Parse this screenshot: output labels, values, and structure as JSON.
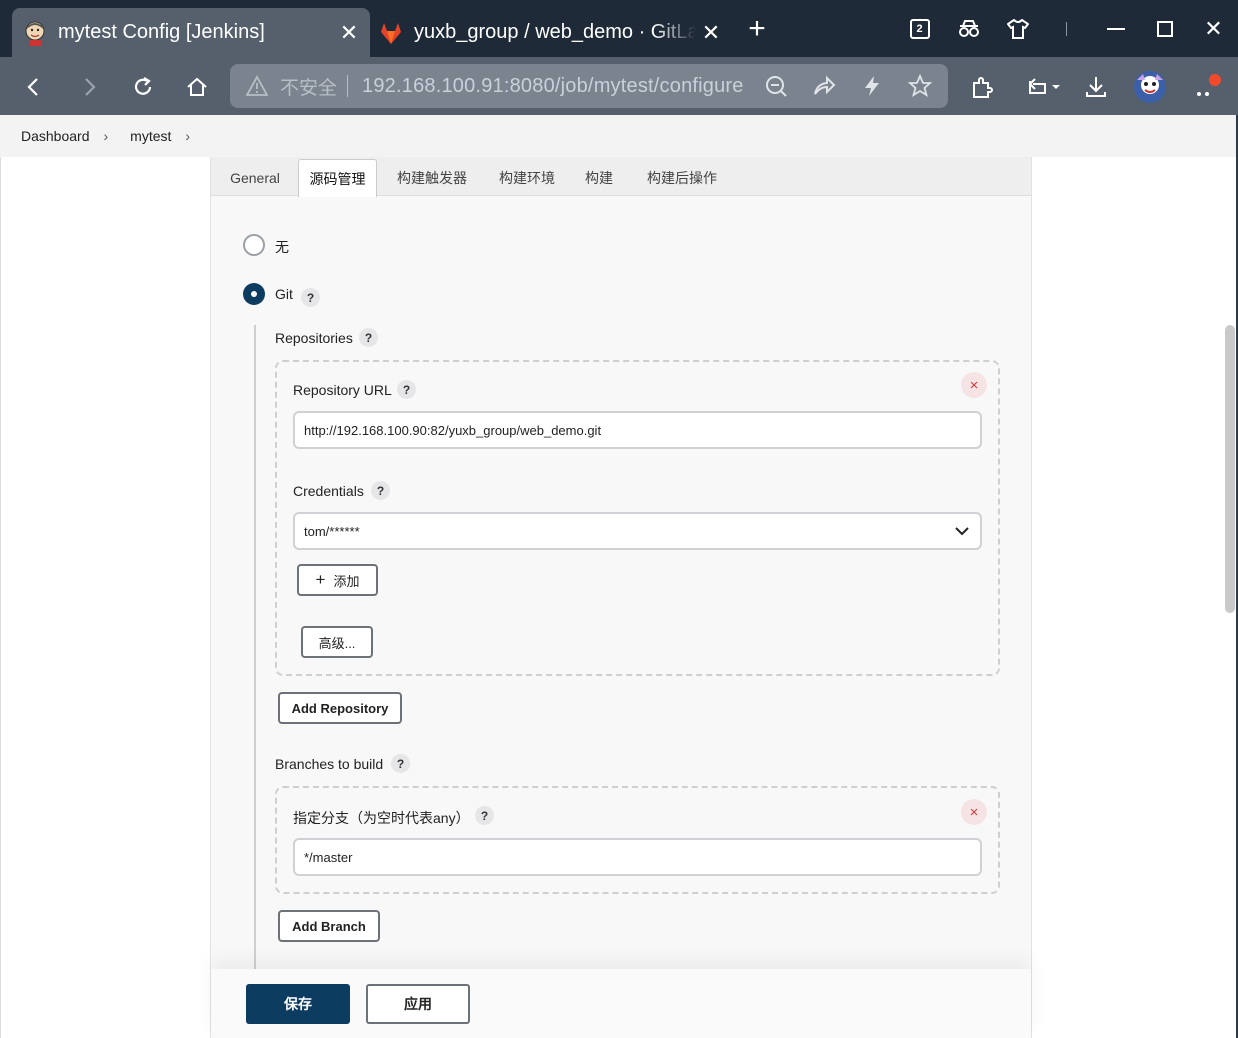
{
  "browser": {
    "tabs": [
      {
        "title": "mytest Config [Jenkins]",
        "active": true,
        "icon": "jenkins-icon"
      },
      {
        "title": "yuxb_group / web_demo · GitLab",
        "active": false,
        "icon": "gitlab-icon"
      }
    ],
    "tab_count": "2",
    "address": {
      "security_label": "不安全",
      "url": "192.168.100.91:8080/job/mytest/configure"
    }
  },
  "breadcrumb": [
    "Dashboard",
    "mytest"
  ],
  "config_tabs": [
    "General",
    "源码管理",
    "构建触发器",
    "构建环境",
    "构建",
    "构建后操作"
  ],
  "selected_tab": "源码管理",
  "scm": {
    "option_none": "无",
    "option_git": "Git",
    "selected": "Git",
    "repositories_label": "Repositories",
    "repository_url_label": "Repository URL",
    "repository_url_value": "http://192.168.100.90:82/yuxb_group/web_demo.git",
    "credentials_label": "Credentials",
    "credentials_value": "tom/******",
    "add_button": "添加",
    "advanced_button": "高级...",
    "add_repository_button": "Add Repository",
    "branches_label": "Branches to build",
    "branch_specifier_label": "指定分支（为空时代表any）",
    "branch_value": "*/master",
    "add_branch_button": "Add Branch",
    "help_glyph": "?",
    "delete_glyph": "×"
  },
  "footer": {
    "save_button": "保存",
    "apply_button": "应用"
  },
  "colors": {
    "primary": "#0d3c61",
    "danger": "#d23b3b",
    "tabbar": "#1f2a38",
    "toolbar": "#55606c"
  }
}
